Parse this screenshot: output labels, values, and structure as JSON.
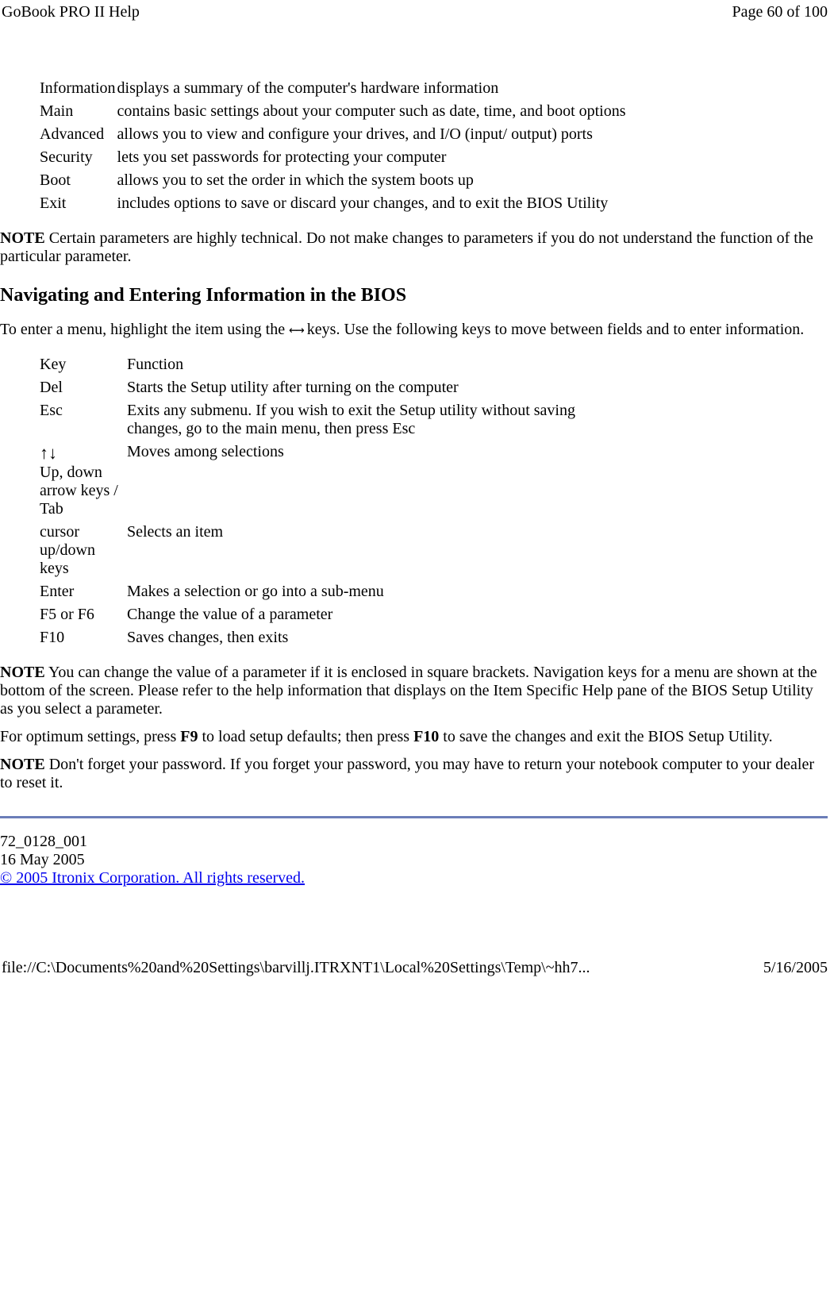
{
  "header": {
    "title": "GoBook PRO II Help",
    "page_label": "Page 60 of 100"
  },
  "menu_table": {
    "rows": [
      {
        "label": "Information",
        "desc": "displays a summary of the computer's hardware information"
      },
      {
        "label": "Main",
        "desc": "contains basic settings about your computer such as date, time, and boot options"
      },
      {
        "label": "Advanced",
        "desc": "allows you to view and configure your drives, and I/O (input/ output) ports"
      },
      {
        "label": "Security",
        "desc": " lets you set passwords for protecting your computer"
      },
      {
        "label": "Boot",
        "desc": "allows you to set the order in which the system boots up"
      },
      {
        "label": "Exit",
        "desc": " includes options to save or discard your changes, and to exit the BIOS Utility"
      }
    ]
  },
  "note1": {
    "label": "NOTE",
    "text": "  Certain parameters are highly technical. Do not make changes to parameters if you do not understand the function of the particular parameter."
  },
  "section_heading": "Navigating and Entering Information in the BIOS",
  "nav_para": {
    "before": "To enter a menu, highlight the item using the",
    "arrows": "←→",
    "after": "  keys. Use the following keys to move between fields and to enter information."
  },
  "keys_table": {
    "header": {
      "key": "Key",
      "func": "Function"
    },
    "rows": [
      {
        "key": "Del",
        "func": "Starts the Setup utility after turning on the computer"
      },
      {
        "key": "Esc",
        "func": "Exits any submenu.  If you wish to exit the Setup utility without saving changes, go to the main menu, then press Esc"
      },
      {
        "key_glyph": "↑↓",
        "key_text": "Up, down arrow keys / Tab",
        "func": "Moves among selections"
      },
      {
        "key": "cursor up/down keys",
        "func": "Selects an item"
      },
      {
        "key": "Enter",
        "func": "Makes a selection or go into a sub-menu"
      },
      {
        "key": "F5 or F6",
        "func": "Change the value of a parameter"
      },
      {
        "key": "F10",
        "func": "Saves changes, then exits"
      }
    ]
  },
  "note2": {
    "label": "NOTE",
    "text": "  You can change the value of a parameter if it is enclosed in square brackets. Navigation keys for a menu are shown at the bottom of the screen. Please refer to the help information that displays on the Item Specific Help pane of the BIOS Setup Utility as you select a parameter."
  },
  "optimum_para": {
    "p1": "For optimum settings, press ",
    "b1": "F9",
    "p2": " to load setup defaults; then press ",
    "b2": "F10",
    "p3": " to save the changes and exit the BIOS Setup Utility."
  },
  "note3": {
    "label": "NOTE",
    "text": " Don't forget your password. If you forget your password, you may have to return your notebook computer to your dealer to reset it."
  },
  "footer_meta": {
    "docnum": " 72_0128_001",
    "date": "16 May 2005",
    "copyright": "© 2005 Itronix Corporation.  All rights reserved."
  },
  "page_footer": {
    "path": "file://C:\\Documents%20and%20Settings\\barvillj.ITRXNT1\\Local%20Settings\\Temp\\~hh7...",
    "date": "5/16/2005"
  }
}
